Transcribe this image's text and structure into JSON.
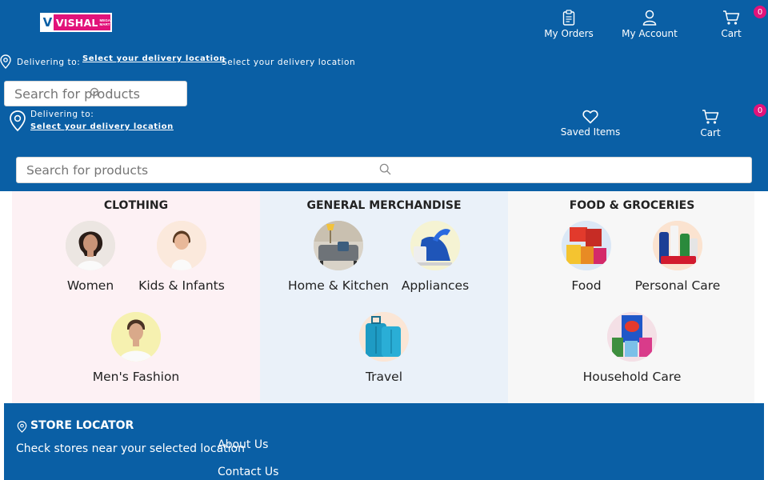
{
  "logo": {
    "brand": "VISHAL",
    "sub1": "MEGA",
    "sub2": "MART"
  },
  "header": {
    "my_orders": "My Orders",
    "my_account": "My Account",
    "cart": "Cart",
    "cart_count": "0",
    "saved_items": "Saved Items",
    "cart2": "Cart",
    "cart2_count": "0"
  },
  "delivery": {
    "label1": "Delivering to:",
    "link1": "Select your delivery location",
    "plain1": "Select your delivery location",
    "label2": "Delivering to:",
    "link2": "Select your delivery location"
  },
  "search": {
    "placeholder1": "Search for products",
    "placeholder2": "Search for products"
  },
  "categories": [
    {
      "title": "CLOTHING",
      "bg": "#fdf1f4",
      "items": [
        {
          "label": "Women",
          "icon": "women-image"
        },
        {
          "label": "Kids & Infants",
          "icon": "kids-image"
        },
        {
          "label": "Men's Fashion",
          "icon": "men-image"
        }
      ]
    },
    {
      "title": "GENERAL MERCHANDISE",
      "bg": "#eaf1f9",
      "items": [
        {
          "label": "Home & Kitchen",
          "icon": "home-kitchen-image"
        },
        {
          "label": "Appliances",
          "icon": "appliances-image"
        },
        {
          "label": "Travel",
          "icon": "travel-image"
        }
      ]
    },
    {
      "title": "FOOD & GROCERIES",
      "bg": "#f7f7f7",
      "items": [
        {
          "label": "Food",
          "icon": "food-image"
        },
        {
          "label": "Personal Care",
          "icon": "personal-care-image"
        },
        {
          "label": "Household Care",
          "icon": "household-care-image"
        }
      ]
    }
  ],
  "footer": {
    "store_locator": "STORE LOCATOR",
    "store_text": "Check stores near your selected location",
    "about": "About Us",
    "contact": "Contact Us"
  },
  "colors": {
    "primary": "#0a5fa5",
    "accent": "#e2137a"
  }
}
